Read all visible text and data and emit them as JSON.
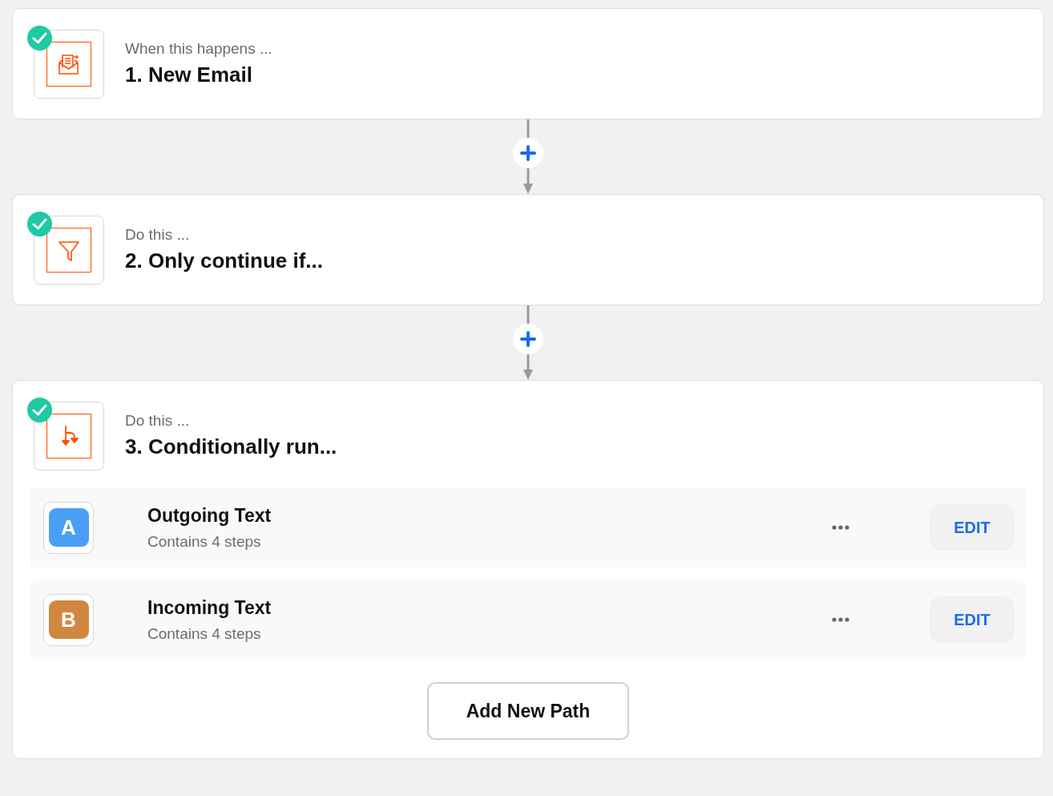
{
  "steps": [
    {
      "kind": "email",
      "completed": true,
      "caption": "When this happens ...",
      "title": "1. New Email"
    },
    {
      "kind": "filter",
      "completed": true,
      "caption": "Do this ...",
      "title": "2. Only continue if..."
    },
    {
      "kind": "paths",
      "completed": true,
      "caption": "Do this ...",
      "title": "3. Conditionally run...",
      "paths": [
        {
          "letter": "A",
          "color": "#4a9ff5",
          "name": "Outgoing Text",
          "detail": "Contains 4 steps",
          "button": "EDIT"
        },
        {
          "letter": "B",
          "color": "#d08840",
          "name": "Incoming Text",
          "detail": "Contains 4 steps",
          "button": "EDIT"
        }
      ],
      "add_button": "Add New Path"
    }
  ]
}
